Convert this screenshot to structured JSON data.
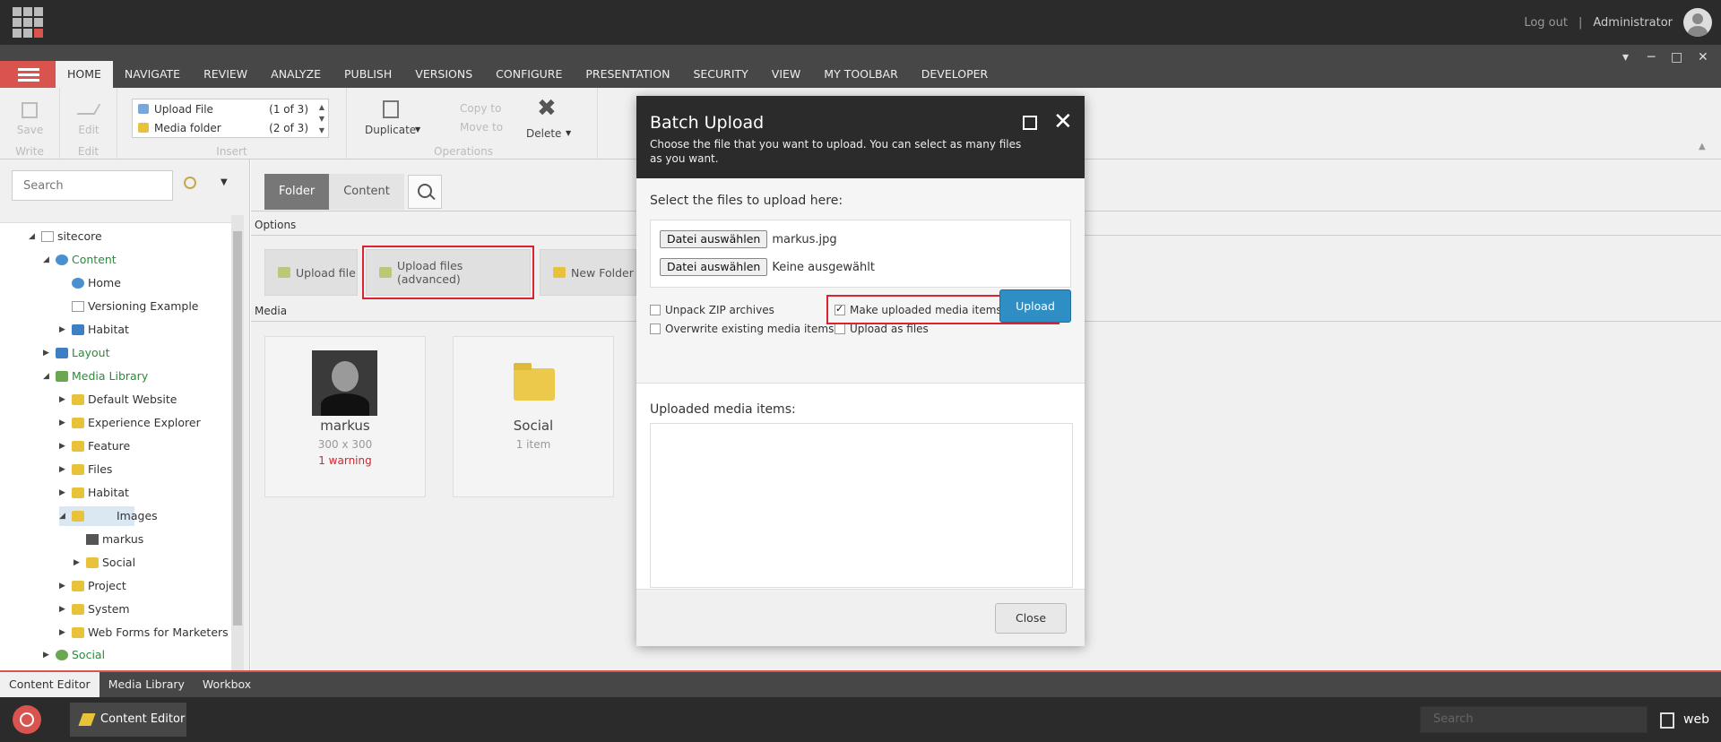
{
  "topbar": {
    "logout": "Log out",
    "separator": "|",
    "user": "Administrator"
  },
  "ribbon": {
    "tabs": [
      "HOME",
      "NAVIGATE",
      "REVIEW",
      "ANALYZE",
      "PUBLISH",
      "VERSIONS",
      "CONFIGURE",
      "PRESENTATION",
      "SECURITY",
      "VIEW",
      "MY TOOLBAR",
      "DEVELOPER"
    ],
    "save": "Save",
    "edit": "Edit",
    "group_write": "Write",
    "group_edit": "Edit",
    "group_insert": "Insert",
    "group_operations": "Operations",
    "insert_items": [
      {
        "label": "Upload File",
        "count": "(1 of 3)"
      },
      {
        "label": "Media folder",
        "count": "(2 of 3)"
      }
    ],
    "duplicate": "Duplicate",
    "copy_to": "Copy to",
    "move_to": "Move to",
    "delete": "Delete"
  },
  "tree": {
    "search_placeholder": "Search",
    "nodes": [
      {
        "label": "sitecore"
      },
      {
        "label": "Content"
      },
      {
        "label": "Home"
      },
      {
        "label": "Versioning Example"
      },
      {
        "label": "Habitat"
      },
      {
        "label": "Layout"
      },
      {
        "label": "Media Library"
      },
      {
        "label": "Default Website"
      },
      {
        "label": "Experience Explorer"
      },
      {
        "label": "Feature"
      },
      {
        "label": "Files"
      },
      {
        "label": "Habitat"
      },
      {
        "label": "Images"
      },
      {
        "label": "markus"
      },
      {
        "label": "Social"
      },
      {
        "label": "Project"
      },
      {
        "label": "System"
      },
      {
        "label": "Web Forms for Marketers"
      },
      {
        "label": "Social"
      }
    ]
  },
  "content": {
    "tabs": [
      "Folder",
      "Content"
    ],
    "options_label": "Options",
    "buttons": [
      "Upload file",
      "Upload files (advanced)",
      "New Folder"
    ],
    "media_label": "Media",
    "cards": [
      {
        "title": "markus",
        "sub": "300 x 300",
        "warn": "1 warning"
      },
      {
        "title": "Social",
        "sub": "1 item"
      }
    ]
  },
  "modal": {
    "title": "Batch Upload",
    "subtitle": "Choose the file that you want to upload. You can select as many files as you want.",
    "select_label": "Select the files to upload here:",
    "file_rows": [
      {
        "button": "Datei auswählen",
        "value": "markus.jpg"
      },
      {
        "button": "Datei auswählen",
        "value": "Keine ausgewählt"
      }
    ],
    "options": [
      {
        "label": "Unpack ZIP archives",
        "checked": false
      },
      {
        "label": "Make uploaded media items versionable",
        "checked": true
      },
      {
        "label": "Overwrite existing media items",
        "checked": false
      },
      {
        "label": "Upload as files",
        "checked": false
      }
    ],
    "upload": "Upload",
    "uploaded_label": "Uploaded media items:",
    "close": "Close"
  },
  "bottom": {
    "tabs": [
      "Content Editor",
      "Media Library",
      "Workbox"
    ],
    "app_button": "Content Editor",
    "search_placeholder": "Search",
    "database": "web"
  },
  "colors": {
    "accent_red": "#d9534f",
    "highlight": "#d9232e",
    "upload_blue": "#2f8fc4"
  }
}
